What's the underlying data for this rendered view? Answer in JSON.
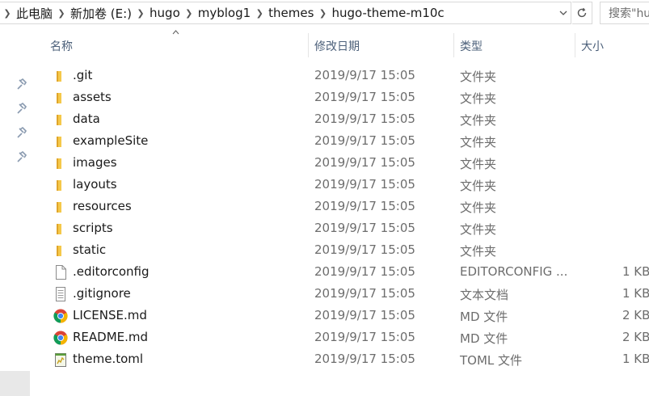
{
  "address_bar": {
    "crumbs": [
      "此电脑",
      "新加卷 (E:)",
      "hugo",
      "myblog1",
      "themes",
      "hugo-theme-m10c"
    ],
    "search_placeholder": "搜索\"hu"
  },
  "columns": {
    "name": "名称",
    "date": "修改日期",
    "type": "类型",
    "size": "大小"
  },
  "files": [
    {
      "name": ".git",
      "date": "2019/9/17 15:05",
      "type": "文件夹",
      "size": "",
      "icon": "folder-icon"
    },
    {
      "name": "assets",
      "date": "2019/9/17 15:05",
      "type": "文件夹",
      "size": "",
      "icon": "folder-icon"
    },
    {
      "name": "data",
      "date": "2019/9/17 15:05",
      "type": "文件夹",
      "size": "",
      "icon": "folder-icon"
    },
    {
      "name": "exampleSite",
      "date": "2019/9/17 15:05",
      "type": "文件夹",
      "size": "",
      "icon": "folder-icon"
    },
    {
      "name": "images",
      "date": "2019/9/17 15:05",
      "type": "文件夹",
      "size": "",
      "icon": "folder-icon"
    },
    {
      "name": "layouts",
      "date": "2019/9/17 15:05",
      "type": "文件夹",
      "size": "",
      "icon": "folder-icon"
    },
    {
      "name": "resources",
      "date": "2019/9/17 15:05",
      "type": "文件夹",
      "size": "",
      "icon": "folder-icon"
    },
    {
      "name": "scripts",
      "date": "2019/9/17 15:05",
      "type": "文件夹",
      "size": "",
      "icon": "folder-icon"
    },
    {
      "name": "static",
      "date": "2019/9/17 15:05",
      "type": "文件夹",
      "size": "",
      "icon": "folder-icon"
    },
    {
      "name": ".editorconfig",
      "date": "2019/9/17 15:05",
      "type": "EDITORCONFIG ...",
      "size": "1 KB",
      "icon": "blank-file-icon"
    },
    {
      "name": ".gitignore",
      "date": "2019/9/17 15:05",
      "type": "文本文档",
      "size": "1 KB",
      "icon": "text-file-icon"
    },
    {
      "name": "LICENSE.md",
      "date": "2019/9/17 15:05",
      "type": "MD 文件",
      "size": "2 KB",
      "icon": "chrome-icon"
    },
    {
      "name": "README.md",
      "date": "2019/9/17 15:05",
      "type": "MD 文件",
      "size": "2 KB",
      "icon": "chrome-icon"
    },
    {
      "name": "theme.toml",
      "date": "2019/9/17 15:05",
      "type": "TOML 文件",
      "size": "1 KB",
      "icon": "toml-file-icon"
    }
  ],
  "colors": {
    "folder": "#f5c84a",
    "header_text": "#4c607a",
    "meta_text": "#6d6d6d"
  }
}
